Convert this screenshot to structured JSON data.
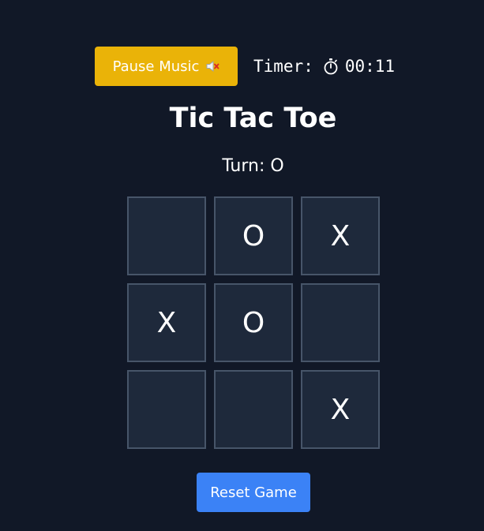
{
  "controls": {
    "music_label": "Pause Music",
    "music_icon": "mute-speaker-icon",
    "timer_label": "Timer:",
    "timer_icon": "stopwatch-icon",
    "timer_value": "00:11",
    "reset_label": "Reset Game"
  },
  "game": {
    "title": "Tic Tac Toe",
    "turn_text": "Turn: O",
    "board": [
      "",
      "O",
      "X",
      "X",
      "O",
      "",
      "",
      "",
      "X"
    ]
  },
  "colors": {
    "background": "#111827",
    "cell_background": "#1e293b",
    "cell_border": "#475569",
    "music_button": "#eab308",
    "reset_button": "#3b82f6"
  }
}
